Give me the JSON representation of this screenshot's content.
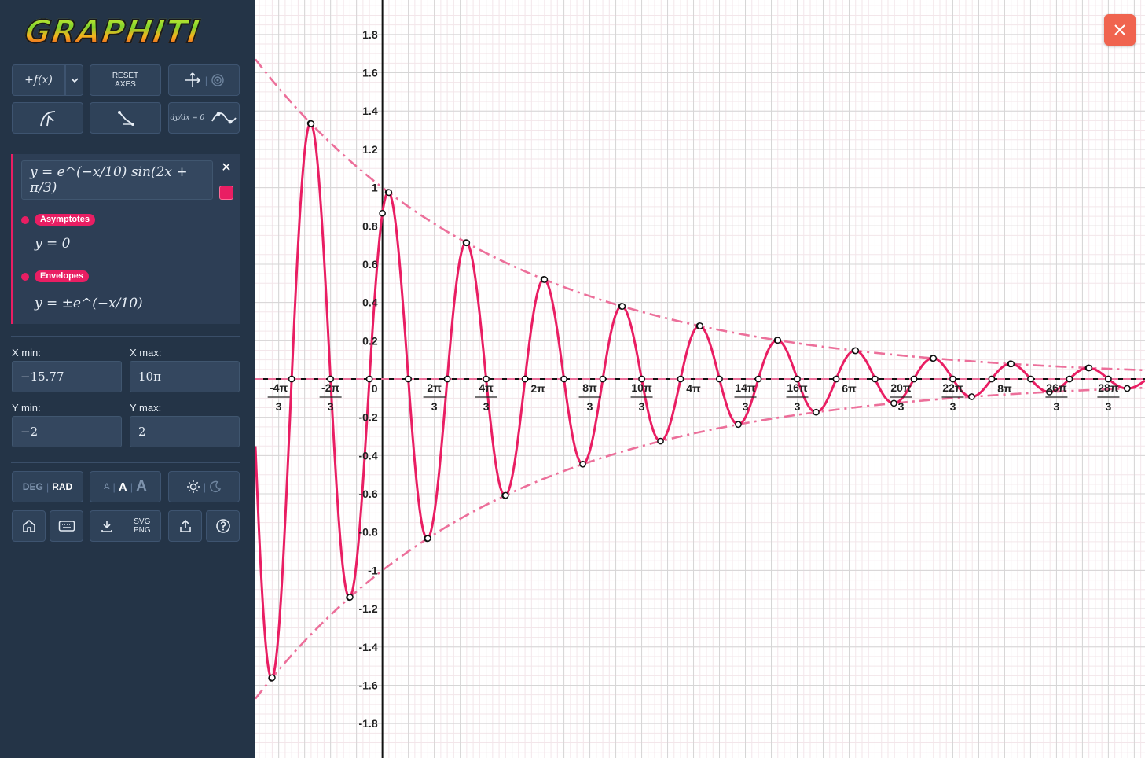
{
  "app": {
    "logo_text": "GRAPHITI"
  },
  "toolbar": {
    "add_function_label": "+f(x)",
    "reset_axes_line1": "RESET",
    "reset_axes_line2": "AXES",
    "deriv_label": "dy/dx = 0"
  },
  "function": {
    "expression": "y = e^(−x/10) sin(2x + π/3)",
    "color": "#e91e63",
    "close_label": "✕",
    "asymptotes_tag": "Asymptotes",
    "asymptotes_value": "y = 0",
    "envelopes_tag": "Envelopes",
    "envelopes_value": "y = ±e^(−x/10)"
  },
  "bounds": {
    "xmin_label": "X min:",
    "xmin_value": "−15.77",
    "xmax_label": "X max:",
    "xmax_value": "10π",
    "ymin_label": "Y min:",
    "ymin_value": "−2",
    "ymax_label": "Y max:",
    "ymax_value": "2"
  },
  "settings": {
    "deg_label": "DEG",
    "rad_label": "RAD",
    "font_small": "A",
    "font_medium": "A",
    "font_large": "A",
    "export_line1": "SVG",
    "export_line2": "PNG"
  },
  "chart_data": {
    "type": "line",
    "title": "",
    "xlabel": "",
    "ylabel": "",
    "xlim": [
      -5.13,
      30.8
    ],
    "ylim": [
      -1.98,
      1.98
    ],
    "grid": true,
    "series": [
      {
        "expression": "exp(-x/10)*sin(2x+pi/3)",
        "color": "#e91e63",
        "style": "solid"
      },
      {
        "expression": "exp(-x/10)",
        "color": "#ec6f9a",
        "style": "dash-dot"
      },
      {
        "expression": "-exp(-x/10)",
        "color": "#ec6f9a",
        "style": "dash-dot"
      }
    ],
    "asymptote": "y = 0",
    "y_ticks": [
      "1.8",
      "1.6",
      "1.4",
      "1.2",
      "1",
      "0.8",
      "0.6",
      "0.4",
      "0.2",
      "-0.2",
      "-0.4",
      "-0.6",
      "-0.8",
      "-1",
      "-1.2",
      "-1.4",
      "-1.6",
      "-1.8"
    ],
    "y_tick_values": [
      1.8,
      1.6,
      1.4,
      1.2,
      1,
      0.8,
      0.6,
      0.4,
      0.2,
      -0.2,
      -0.4,
      -0.6,
      -0.8,
      -1,
      -1.2,
      -1.4,
      -1.6,
      -1.8
    ],
    "x_ticks": [
      {
        "value": -4.18879,
        "num": "-4π",
        "den": "3"
      },
      {
        "value": -2.0944,
        "num": "-2π",
        "den": "3"
      },
      {
        "value": 0,
        "num": "0",
        "den": ""
      },
      {
        "value": 2.0944,
        "num": "2π",
        "den": "3"
      },
      {
        "value": 4.18879,
        "num": "4π",
        "den": "3"
      },
      {
        "value": 6.28319,
        "num": "2π",
        "den": ""
      },
      {
        "value": 8.37758,
        "num": "8π",
        "den": "3"
      },
      {
        "value": 10.47198,
        "num": "10π",
        "den": "3"
      },
      {
        "value": 12.56637,
        "num": "4π",
        "den": ""
      },
      {
        "value": 14.66077,
        "num": "14π",
        "den": "3"
      },
      {
        "value": 16.75516,
        "num": "16π",
        "den": "3"
      },
      {
        "value": 18.84956,
        "num": "6π",
        "den": ""
      },
      {
        "value": 20.94395,
        "num": "20π",
        "den": "3"
      },
      {
        "value": 23.03835,
        "num": "22π",
        "den": "3"
      },
      {
        "value": 25.13274,
        "num": "8π",
        "den": ""
      },
      {
        "value": 27.22714,
        "num": "26π",
        "den": "3"
      },
      {
        "value": 29.32153,
        "num": "28π",
        "den": "3"
      }
    ]
  }
}
